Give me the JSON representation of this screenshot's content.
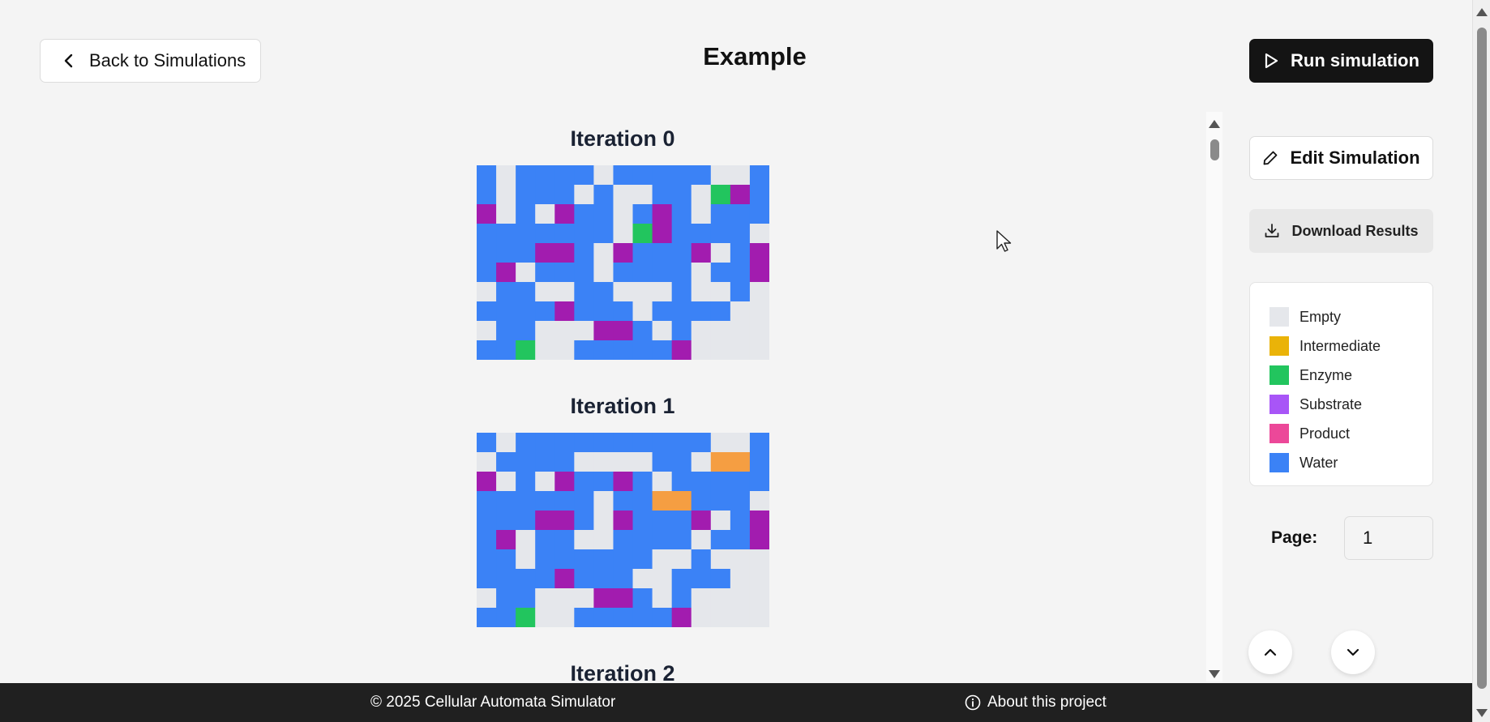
{
  "header": {
    "back_label": "Back to Simulations",
    "title": "Example",
    "run_label": "Run simulation"
  },
  "sidebar": {
    "edit_label": "Edit Simulation",
    "download_label": "Download Results",
    "legend": [
      {
        "label": "Empty",
        "color": "#e5e7eb"
      },
      {
        "label": "Intermediate",
        "color": "#eab308"
      },
      {
        "label": "Enzyme",
        "color": "#22c55e"
      },
      {
        "label": "Substrate",
        "color": "#a855f7"
      },
      {
        "label": "Product",
        "color": "#ec4899"
      },
      {
        "label": "Water",
        "color": "#3b82f6"
      }
    ],
    "page_label": "Page:",
    "page_value": "1"
  },
  "cell_colors": {
    "E": "#e5e7eb",
    "W": "#3b82f6",
    "G": "#22c55e",
    "P": "#a21caf",
    "O": "#f59e42"
  },
  "iterations": [
    {
      "title": "Iteration 0",
      "rows": [
        "WEWWWWEWWWWWEEW",
        "WEWWWEWEEWWEGPW",
        "PEWEPWWEWPWEWWW",
        "WWWWWWWEGPWWWWE",
        "WWWPPWEPWWWPEWP",
        "WPEWWWEWWWWEWWP",
        "EWWEEWWEEEWEEWE",
        "WWWWPWWWEWWWWEE",
        "EWWEEEPPWEWEEEE",
        "WWGEEWWWWWPEEEE"
      ]
    },
    {
      "title": "Iteration 1",
      "rows": [
        "WEWWWWWWWWWWEEW",
        "EWWWWEEEEWWEOOW",
        "PEWEPWWPWEWWWWW",
        "WWWWWWEWWOOWWWE",
        "WWWPPWEPWWWPEWP",
        "WPEWWEEWWWWEWWP",
        "WWEWWWWWWEEWEEE",
        "WWWWPWWWEEWWWEE",
        "EWWEEEPPWEWEEEE",
        "WWGEEWWWWWPEEEE"
      ]
    },
    {
      "title": "Iteration 2",
      "rows": []
    }
  ],
  "footer": {
    "copyright": "© 2025 Cellular Automata Simulator",
    "about_label": "About this project"
  }
}
